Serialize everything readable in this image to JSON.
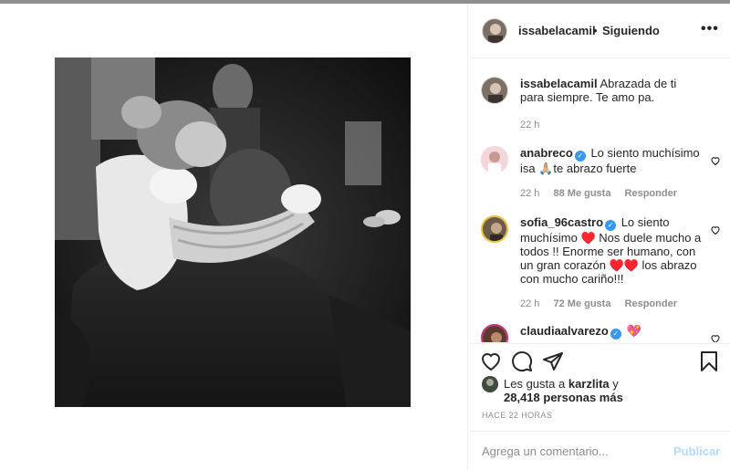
{
  "post": {
    "username": "issabelacamil",
    "separator": "•",
    "follow_status": "Siguiendo",
    "more": "•••"
  },
  "caption": {
    "username": "issabelacamil",
    "text": "Abrazada de ti para siempre. Te amo pa.",
    "time": "22 h"
  },
  "comments": [
    {
      "username": "anabreco",
      "text": "Lo siento muchísimo isa 🙏🏼te abrazo fuerte",
      "time": "22 h",
      "likes": "88 Me gusta",
      "reply": "Responder"
    },
    {
      "username": "sofia_96castro",
      "text": "Lo siento muchísimo ♥️ Nos duele mucho a todos !! Enorme ser humano, con un gran corazón ♥️♥️ los abrazo con mucho cariño!!!",
      "time": "22 h",
      "likes": "72 Me gusta",
      "reply": "Responder"
    },
    {
      "username": "claudiaalvarezo",
      "text": "💖"
    }
  ],
  "likes": {
    "prefix": "Les gusta a",
    "user": "karzlita",
    "suffix": "y",
    "count": "28,418 personas más"
  },
  "timestamp": "HACE 22 HORAS",
  "add_comment": {
    "placeholder": "Agrega un comentario...",
    "post_label": "Publicar"
  },
  "icons": {
    "verified": "verified-badge-icon",
    "like": "heart-icon",
    "comment": "comment-icon",
    "share": "paper-plane-icon",
    "save": "bookmark-icon"
  },
  "colors": {
    "verified": "#3897f0",
    "muted": "#8e8e8e",
    "publish_disabled": "#b3dbff"
  }
}
